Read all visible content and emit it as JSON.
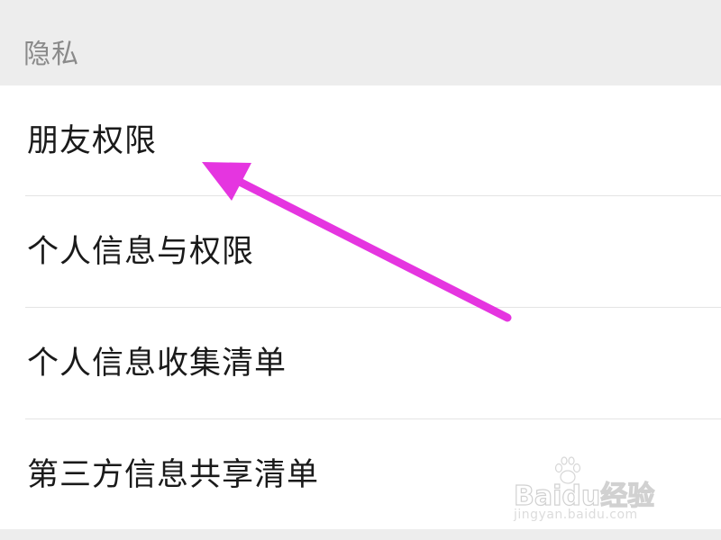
{
  "section": {
    "title": "隐私"
  },
  "items": [
    {
      "label": "朋友权限"
    },
    {
      "label": "个人信息与权限"
    },
    {
      "label": "个人信息收集清单"
    },
    {
      "label": "第三方信息共享清单"
    }
  ],
  "annotation": {
    "icon": "arrow-icon",
    "color": "#e535e0"
  },
  "watermark": {
    "brand": "Baidu经验",
    "url": "jingyan.baidu.com"
  },
  "colors": {
    "background": "#ededed",
    "list_background": "#ffffff",
    "section_title": "#8a8a8a",
    "item_text": "#1a1a1a",
    "divider": "#e4e4e4"
  }
}
